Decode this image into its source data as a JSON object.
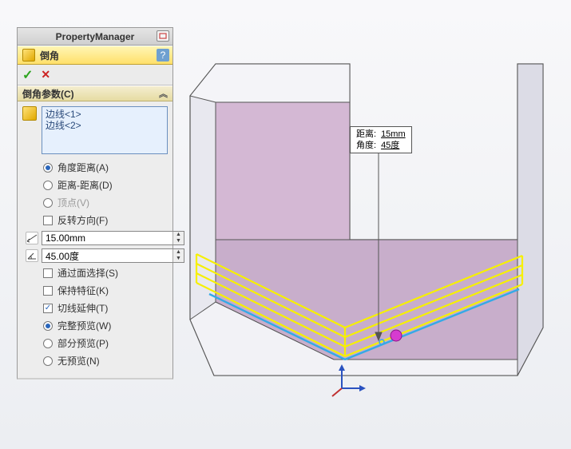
{
  "pm": {
    "title": "PropertyManager"
  },
  "feature": {
    "title": "倒角",
    "help": "?"
  },
  "buttons": {
    "ok": "✓",
    "cancel": "✕"
  },
  "section": {
    "header": "倒角参数(C)",
    "selection": {
      "items": [
        "边线<1>",
        "边线<2>"
      ]
    },
    "radios_type": {
      "angle_distance": "角度距离(A)",
      "distance_distance": "距离-距离(D)",
      "vertex": "顶点(V)"
    },
    "checks": {
      "reverse": "反转方向(F)",
      "face_select": "通过面选择(S)",
      "keep_feature": "保持特征(K)",
      "tangent_ext": "切线延伸(T)"
    },
    "params": {
      "distance": "15.00mm",
      "angle": "45.00度"
    },
    "radios_preview": {
      "full": "完整预览(W)",
      "partial": "部分预览(P)",
      "none": "无预览(N)"
    }
  },
  "callout": {
    "labels": {
      "distance": "距离:",
      "angle": "角度:"
    },
    "values": {
      "distance": "15mm",
      "angle": "45度"
    }
  },
  "colors": {
    "accent": "#ffe06a",
    "edge_preview": "#f6f000",
    "edge_select": "#35a9e6",
    "model_face": "#d4b8d4"
  }
}
